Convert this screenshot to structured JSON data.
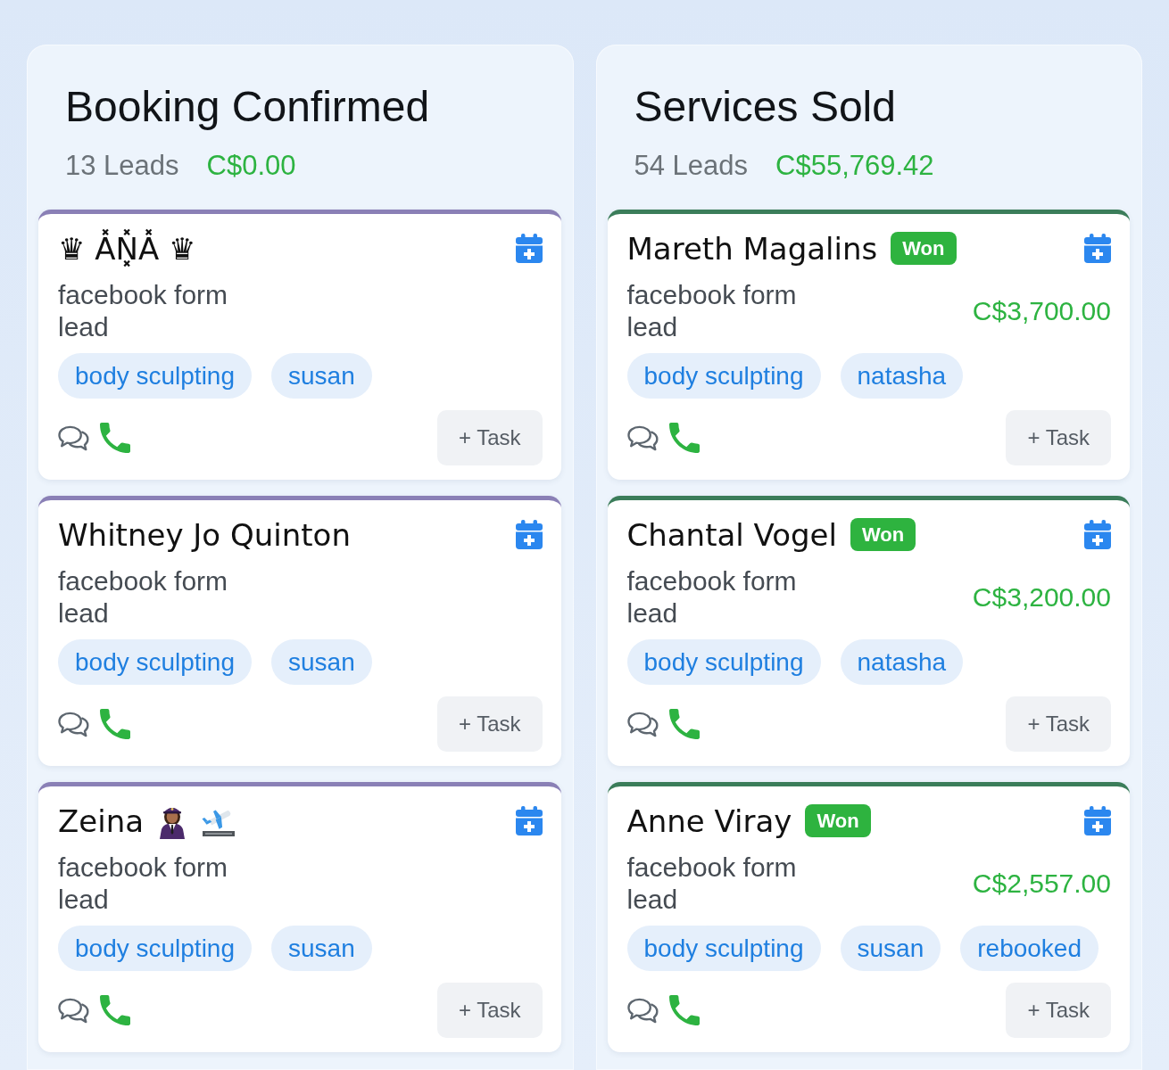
{
  "stages": [
    {
      "title": "Booking Confirmed",
      "leads": "13 Leads",
      "total": "C$0.00",
      "color": "#8a80b6",
      "cards": [
        {
          "name": "♛ A̽N͓̽A̽ ♛",
          "source": "facebook form lead",
          "tags": [
            "body sculpting",
            "susan"
          ],
          "task_button": "+ Task"
        },
        {
          "name": "Whitney Jo Quinton",
          "source": "facebook form lead",
          "tags": [
            "body sculpting",
            "susan"
          ],
          "task_button": "+ Task"
        },
        {
          "name": "Zeina",
          "name_icons": [
            {
              "kind": "pilot"
            },
            {
              "kind": "plane-departure"
            }
          ],
          "source": "facebook form lead",
          "tags": [
            "body sculpting",
            "susan"
          ],
          "task_button": "+ Task"
        }
      ]
    },
    {
      "title": "Services Sold",
      "leads": "54 Leads",
      "total": "C$55,769.42",
      "color": "#3b7d5a",
      "cards": [
        {
          "name": "Mareth Magalins",
          "badge": "Won",
          "source": "facebook form lead",
          "amount": "C$3,700.00",
          "tags": [
            "body sculpting",
            "natasha"
          ],
          "task_button": "+ Task"
        },
        {
          "name": "Chantal Vogel",
          "badge": "Won",
          "source": "facebook form lead",
          "amount": "C$3,200.00",
          "tags": [
            "body sculpting",
            "natasha"
          ],
          "task_button": "+ Task"
        },
        {
          "name": "Anne Viray",
          "badge": "Won",
          "source": "facebook form lead",
          "amount": "C$2,557.00",
          "tags": [
            "body sculpting",
            "susan",
            "rebooked"
          ],
          "task_button": "+ Task"
        }
      ]
    }
  ]
}
